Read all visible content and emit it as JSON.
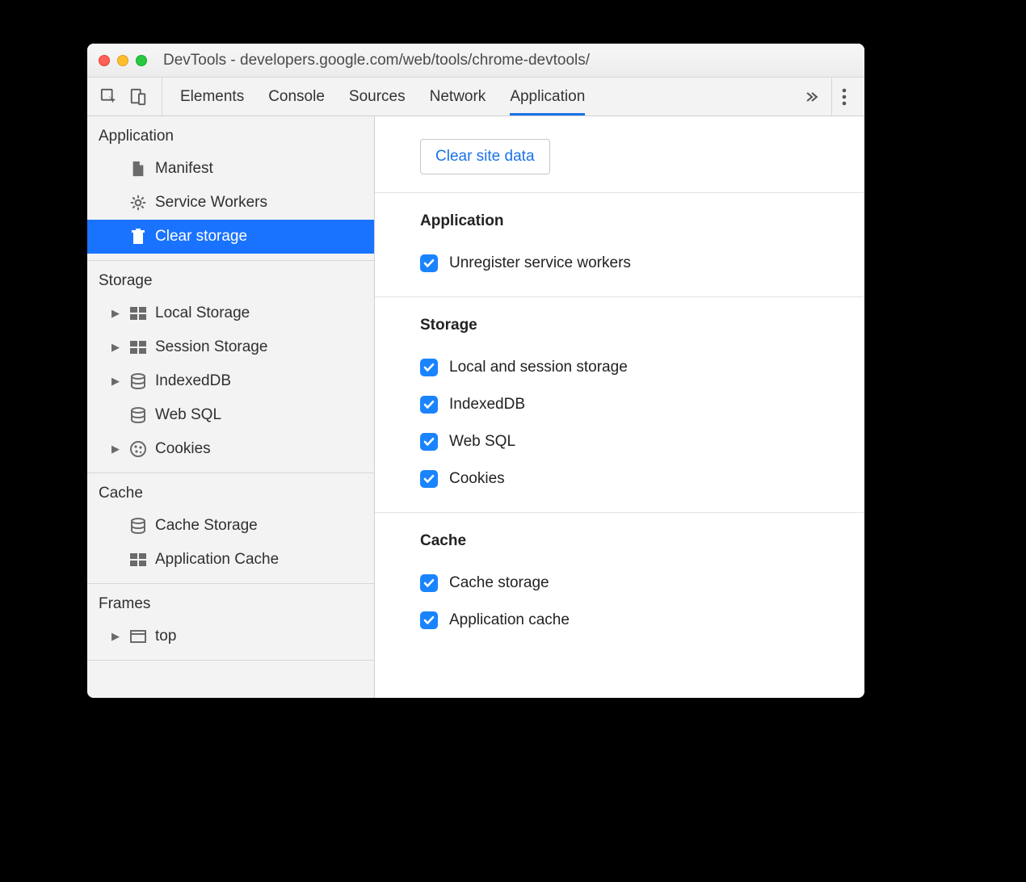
{
  "window": {
    "title": "DevTools - developers.google.com/web/tools/chrome-devtools/"
  },
  "tabs": {
    "items": [
      "Elements",
      "Console",
      "Sources",
      "Network",
      "Application"
    ],
    "active": 4
  },
  "sidebar": {
    "groups": [
      {
        "title": "Application",
        "items": [
          {
            "label": "Manifest",
            "icon": "file",
            "expandable": false
          },
          {
            "label": "Service Workers",
            "icon": "gear",
            "expandable": false
          },
          {
            "label": "Clear storage",
            "icon": "trash",
            "expandable": false,
            "selected": true
          }
        ]
      },
      {
        "title": "Storage",
        "items": [
          {
            "label": "Local Storage",
            "icon": "grid",
            "expandable": true
          },
          {
            "label": "Session Storage",
            "icon": "grid",
            "expandable": true
          },
          {
            "label": "IndexedDB",
            "icon": "db",
            "expandable": true
          },
          {
            "label": "Web SQL",
            "icon": "db",
            "expandable": false
          },
          {
            "label": "Cookies",
            "icon": "cookie",
            "expandable": true
          }
        ]
      },
      {
        "title": "Cache",
        "items": [
          {
            "label": "Cache Storage",
            "icon": "db",
            "expandable": false
          },
          {
            "label": "Application Cache",
            "icon": "grid",
            "expandable": false
          }
        ]
      },
      {
        "title": "Frames",
        "items": [
          {
            "label": "top",
            "icon": "frame",
            "expandable": true
          }
        ]
      }
    ]
  },
  "main": {
    "clear_button": "Clear site data",
    "sections": [
      {
        "title": "Application",
        "options": [
          {
            "label": "Unregister service workers",
            "checked": true
          }
        ]
      },
      {
        "title": "Storage",
        "options": [
          {
            "label": "Local and session storage",
            "checked": true
          },
          {
            "label": "IndexedDB",
            "checked": true
          },
          {
            "label": "Web SQL",
            "checked": true
          },
          {
            "label": "Cookies",
            "checked": true
          }
        ]
      },
      {
        "title": "Cache",
        "options": [
          {
            "label": "Cache storage",
            "checked": true
          },
          {
            "label": "Application cache",
            "checked": true
          }
        ]
      }
    ]
  }
}
